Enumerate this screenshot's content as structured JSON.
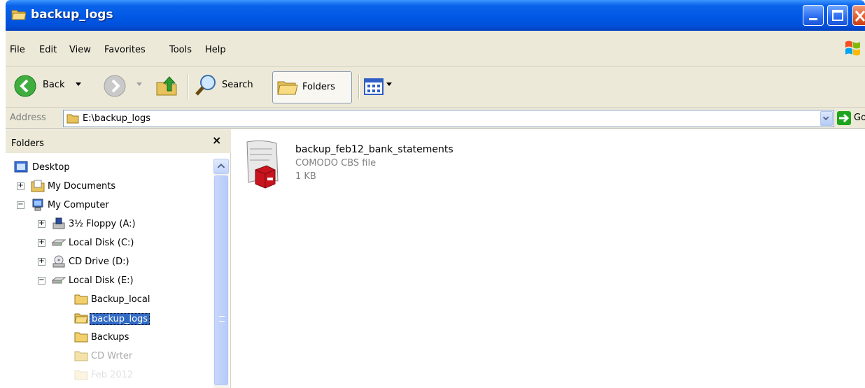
{
  "window": {
    "title": "backup_logs"
  },
  "menu": {
    "file": "File",
    "edit": "Edit",
    "view": "View",
    "favorites": "Favorites",
    "tools": "Tools",
    "help": "Help"
  },
  "toolbar": {
    "back": "Back",
    "search": "Search",
    "folders": "Folders"
  },
  "address": {
    "label": "Address",
    "path": "E:\\backup_logs",
    "go": "Go"
  },
  "folders_pane": {
    "title": "Folders",
    "close": "×",
    "tree": [
      {
        "label": "Desktop"
      },
      {
        "label": "My Documents"
      },
      {
        "label": "My Computer"
      },
      {
        "label": "3½ Floppy (A:)"
      },
      {
        "label": "Local Disk (C:)"
      },
      {
        "label": "CD Drive (D:)"
      },
      {
        "label": "Local Disk (E:)"
      },
      {
        "label": "Backup_local"
      },
      {
        "label": "backup_logs"
      },
      {
        "label": "Backups"
      },
      {
        "label": "CD Wrter"
      },
      {
        "label": "Feb 2012"
      }
    ]
  },
  "file": {
    "name": "backup_feb12_bank_statements",
    "type": "COMODO CBS file",
    "size": "1 KB"
  },
  "colors": {
    "title_bar": "#0058e5",
    "selection": "#316ac5",
    "chrome": "#ece9d8"
  }
}
